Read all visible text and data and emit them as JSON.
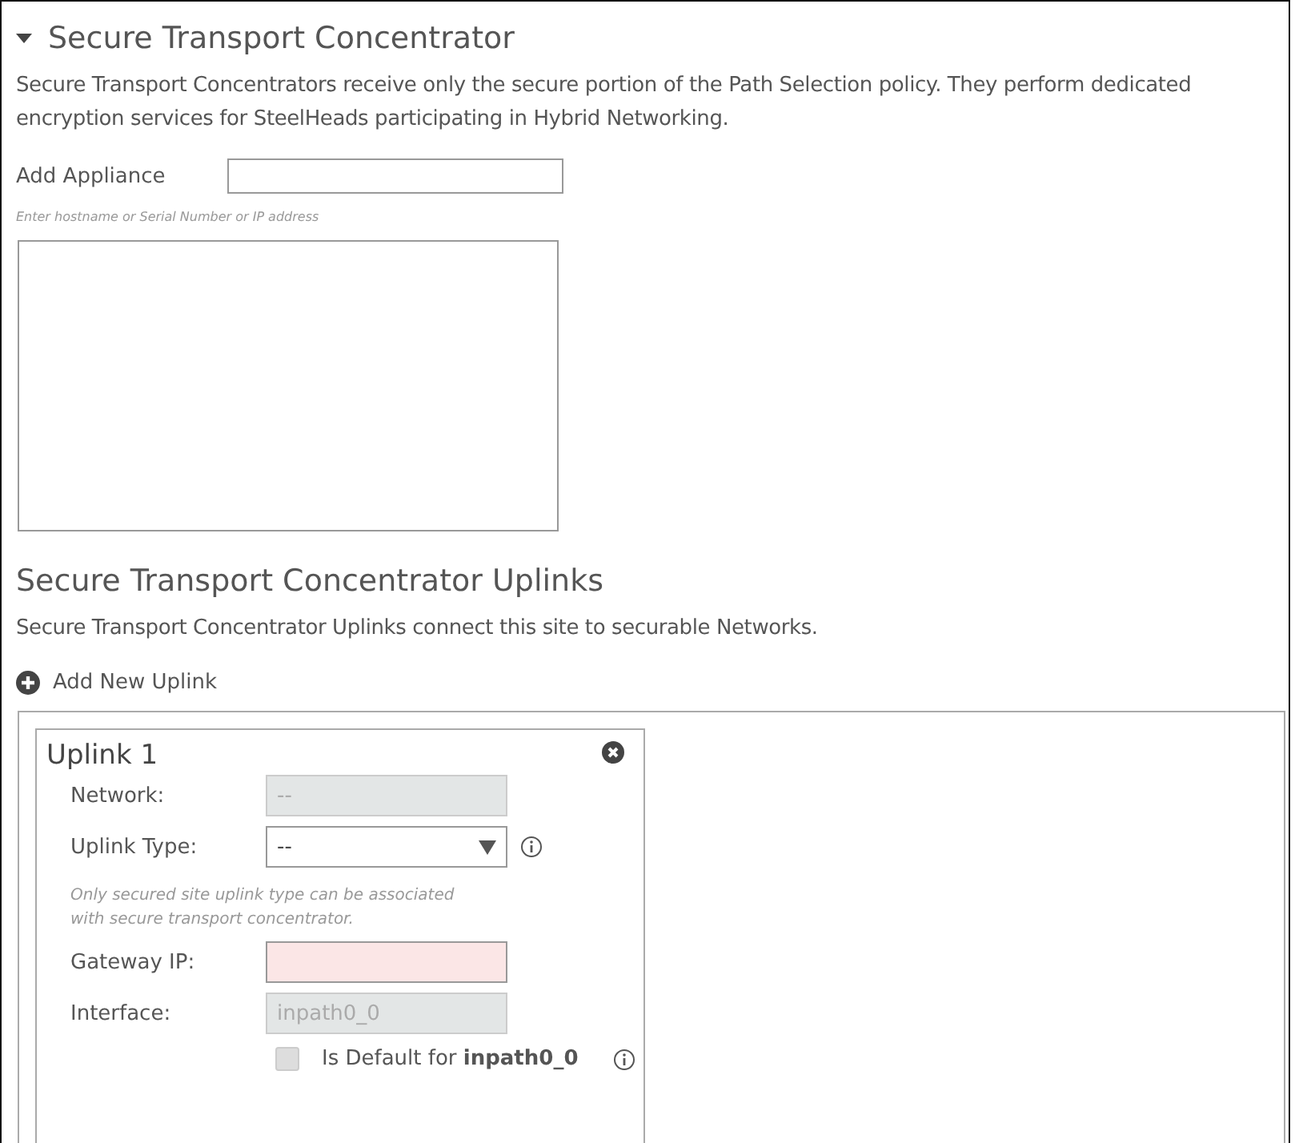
{
  "section": {
    "title": "Secure Transport Concentrator",
    "expanded": true,
    "description": "Secure Transport Concentrators receive only the secure portion of the Path Selection policy. They perform dedicated encryption services for SteelHeads participating in Hybrid Networking.",
    "add_appliance": {
      "label": "Add Appliance",
      "hint": "Enter hostname or Serial Number or IP address"
    }
  },
  "uplinks": {
    "title": "Secure Transport Concentrator Uplinks",
    "description": "Secure Transport Concentrator Uplinks connect this site to securable Networks.",
    "add_button": "Add New Uplink",
    "cards": [
      {
        "title": "Uplink 1",
        "fields": [
          {
            "kind": "text",
            "label": "Network:",
            "value": "--",
            "disabled": true,
            "invalid": false
          },
          {
            "kind": "select",
            "label": "Uplink Type:",
            "value": "--",
            "disabled": false,
            "invalid": false,
            "info": true,
            "note": "Only secured site uplink type can be associated with secure transport concentrator."
          },
          {
            "kind": "text",
            "label": "Gateway IP:",
            "disabled": false,
            "invalid": true
          },
          {
            "kind": "text",
            "label": "Interface:",
            "value": "inpath0_0",
            "disabled": true,
            "invalid": false
          }
        ],
        "default_checkbox": {
          "label": "Is Default for **inpath0_0**",
          "checked": false,
          "disabled": true
        }
      }
    ]
  }
}
